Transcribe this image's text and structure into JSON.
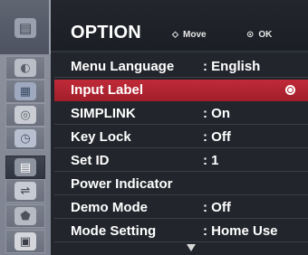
{
  "menu": {
    "title": "OPTION",
    "move_hint": "Move",
    "ok_hint": "OK",
    "move_glyph": "⬦",
    "ok_glyph": "⊙"
  },
  "side_icons": [
    {
      "name": "picture-icon",
      "glyph": "▦"
    },
    {
      "name": "audio-icon",
      "glyph": "◎"
    },
    {
      "name": "time-icon",
      "glyph": "◷"
    },
    {
      "name": "option-icon",
      "glyph": "▤"
    },
    {
      "name": "input-icon",
      "glyph": "⇌"
    },
    {
      "name": "lock-icon",
      "glyph": "⬟"
    },
    {
      "name": "media-icon",
      "glyph": "▣"
    }
  ],
  "rows": [
    {
      "label": "Menu Language",
      "value": ": English"
    },
    {
      "label": "Input Label",
      "value": ""
    },
    {
      "label": "SIMPLINK",
      "value": ": On"
    },
    {
      "label": "Key Lock",
      "value": ": Off"
    },
    {
      "label": "Set ID",
      "value": ": 1"
    },
    {
      "label": "Power Indicator",
      "value": ""
    },
    {
      "label": "Demo Mode",
      "value": ": Off"
    },
    {
      "label": "Mode Setting",
      "value": ": Home Use"
    }
  ],
  "colors": {
    "selected_row": "#b52532",
    "panel": "#22252c"
  }
}
